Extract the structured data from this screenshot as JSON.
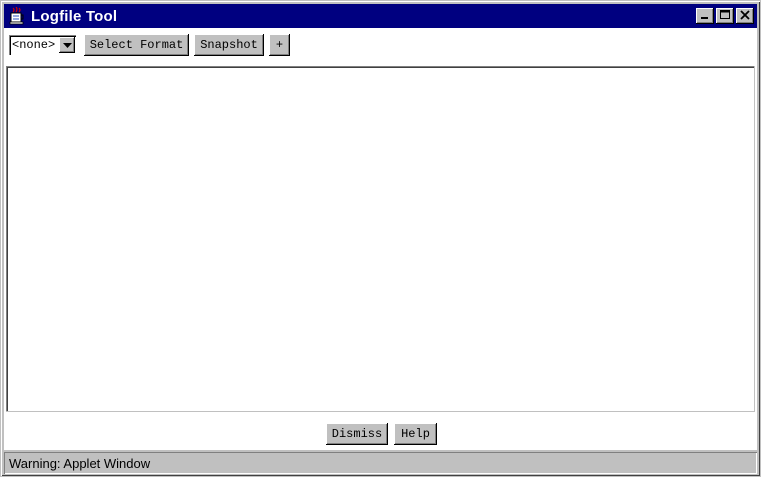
{
  "window": {
    "title": "Logfile Tool",
    "title_bar_color": "#000080",
    "app_icon": "java-cup-icon",
    "controls": [
      "minimize-icon",
      "maximize-icon",
      "close-icon"
    ]
  },
  "toolbar": {
    "format_select": {
      "value": "<none>"
    },
    "select_format_label": "Select Format",
    "snapshot_label": "Snapshot",
    "add_label": "+"
  },
  "footer": {
    "dismiss_label": "Dismiss",
    "help_label": "Help"
  },
  "status": {
    "text": "Warning: Applet Window"
  }
}
